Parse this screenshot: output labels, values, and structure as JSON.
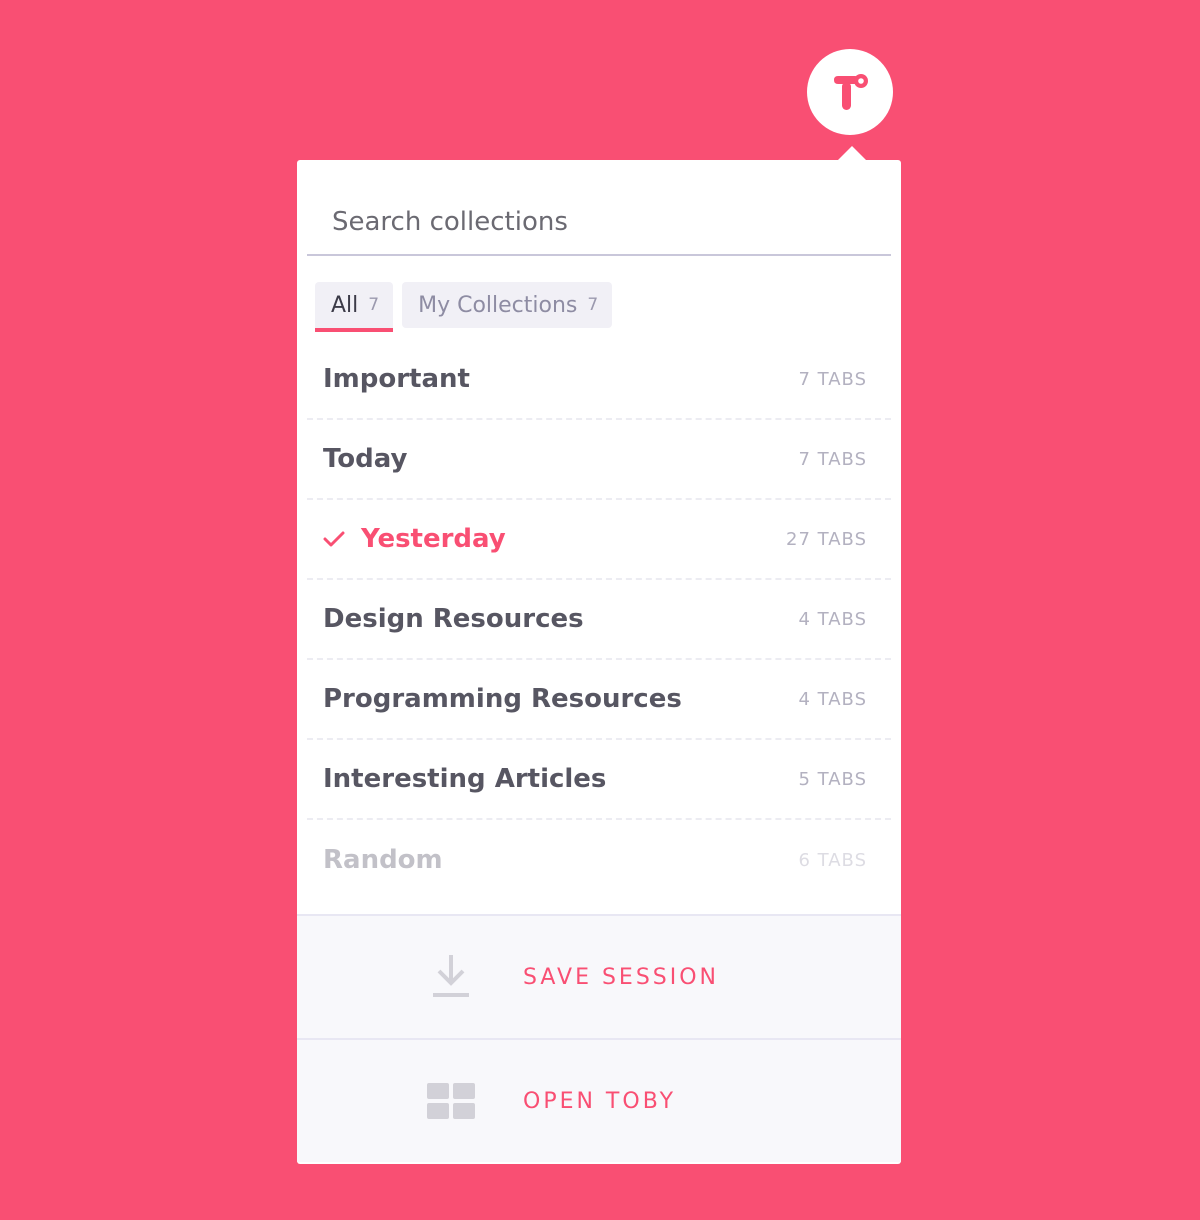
{
  "search": {
    "placeholder": "Search collections"
  },
  "filters": [
    {
      "label": "All",
      "count": "7"
    },
    {
      "label": "My Collections",
      "count": "7"
    }
  ],
  "collections": [
    {
      "title": "Important",
      "count": "7 TABS"
    },
    {
      "title": "Today",
      "count": "7 TABS"
    },
    {
      "title": "Yesterday",
      "count": "27 TABS"
    },
    {
      "title": "Design Resources",
      "count": "4 TABS"
    },
    {
      "title": "Programming Resources",
      "count": "4 TABS"
    },
    {
      "title": "Interesting Articles",
      "count": "5 TABS"
    },
    {
      "title": "Random",
      "count": "6 TABS"
    }
  ],
  "actions": {
    "save_label": "SAVE SESSION",
    "open_label": "OPEN TOBY"
  },
  "icons": {
    "logo": "toby-logo-icon",
    "selected": "checkmark-icon",
    "save": "download-icon",
    "open": "grid-icon"
  },
  "colors": {
    "background": "#f94f73",
    "accent": "#f94f73",
    "panel": "#ffffff",
    "footer": "#f8f8fb"
  }
}
